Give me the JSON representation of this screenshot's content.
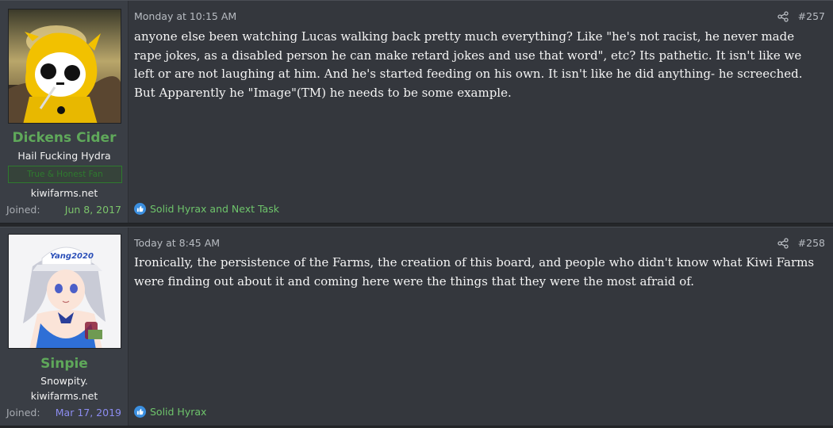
{
  "posts": [
    {
      "time": "Monday at 10:15 AM",
      "number": "#257",
      "username": "Dickens Cider",
      "user_title": "Hail Fucking Hydra",
      "banner": "True & Honest Fan",
      "site": "kiwifarms.net",
      "joined_label": "Joined:",
      "joined_date": "Jun 8, 2017",
      "message": "anyone else been watching Lucas walking back pretty much everything? Like \"he's not racist, he never made rape jokes, as a disabled person he can make retard jokes and use that word\", etc? Its pathetic. It isn't like we left or are not laughing at him. And he's started feeding on his own. It isn't like he did anything- he screeched. But Apparently he \"Image\"(TM) he needs to be some example.",
      "reactions": "Solid Hyrax and Next Task"
    },
    {
      "time": "Today at 8:45 AM",
      "number": "#258",
      "username": "Sinpie",
      "user_title": "Snowpity.",
      "site": "kiwifarms.net",
      "joined_label": "Joined:",
      "joined_date": "Mar 17, 2019",
      "message": "Ironically, the persistence of the Farms, the creation of this board, and people who didn't know what Kiwi Farms were finding out about it and coming here were the things that they were the most afraid of.",
      "reactions": "Solid Hyrax",
      "avatar_cap_text": "Yang2020"
    }
  ],
  "colors": {
    "post_bg": "#34373d",
    "user_cell_bg": "#3a3e45",
    "username": "#5fa85a",
    "reaction_text": "#6ec46b",
    "like_icon": "#3b8fe0"
  },
  "icons": {
    "share": "share-icon",
    "like": "thumbs-up-icon"
  }
}
